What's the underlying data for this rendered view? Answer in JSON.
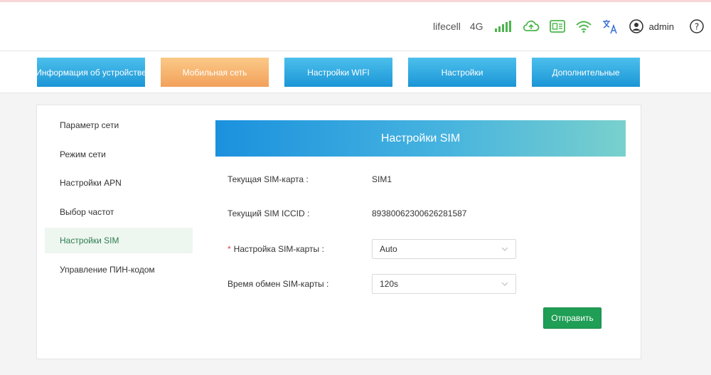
{
  "status": {
    "carrier": "lifecell",
    "network_type": "4G",
    "signal_level": "5/5",
    "user": "admin",
    "accent_green": "#4cb64c",
    "icons": [
      "signal-icon",
      "cloud-sync-icon",
      "sim-card-icon",
      "wifi-icon",
      "translate-icon",
      "user-icon",
      "help-icon"
    ]
  },
  "nav": {
    "tabs": [
      {
        "label": "Информация об устройстве"
      },
      {
        "label": "Мобильная сеть"
      },
      {
        "label": "Настройки WIFI"
      },
      {
        "label": "Настройки"
      },
      {
        "label": "Дополнительные"
      }
    ]
  },
  "sidebar": {
    "items": [
      {
        "label": "Параметр сети"
      },
      {
        "label": "Режим сети"
      },
      {
        "label": "Настройки APN"
      },
      {
        "label": "Выбор частот"
      },
      {
        "label": "Настройки SIM"
      },
      {
        "label": "Управление ПИН-кодом"
      }
    ]
  },
  "main": {
    "title": "Настройки SIM",
    "current_sim": {
      "label": "Текущая SIM-карта :",
      "value": "SIM1"
    },
    "current_iccid": {
      "label": "Текущий SIM ICCID :",
      "value": "89380062300626281587"
    },
    "sim_setting": {
      "required_mark": "*",
      "label": "Настройка SIM-карты :",
      "value": "Auto"
    },
    "switch_time": {
      "label": "Время обмен SIM-карты :",
      "value": "120s"
    },
    "submit_label": "Отправить"
  }
}
